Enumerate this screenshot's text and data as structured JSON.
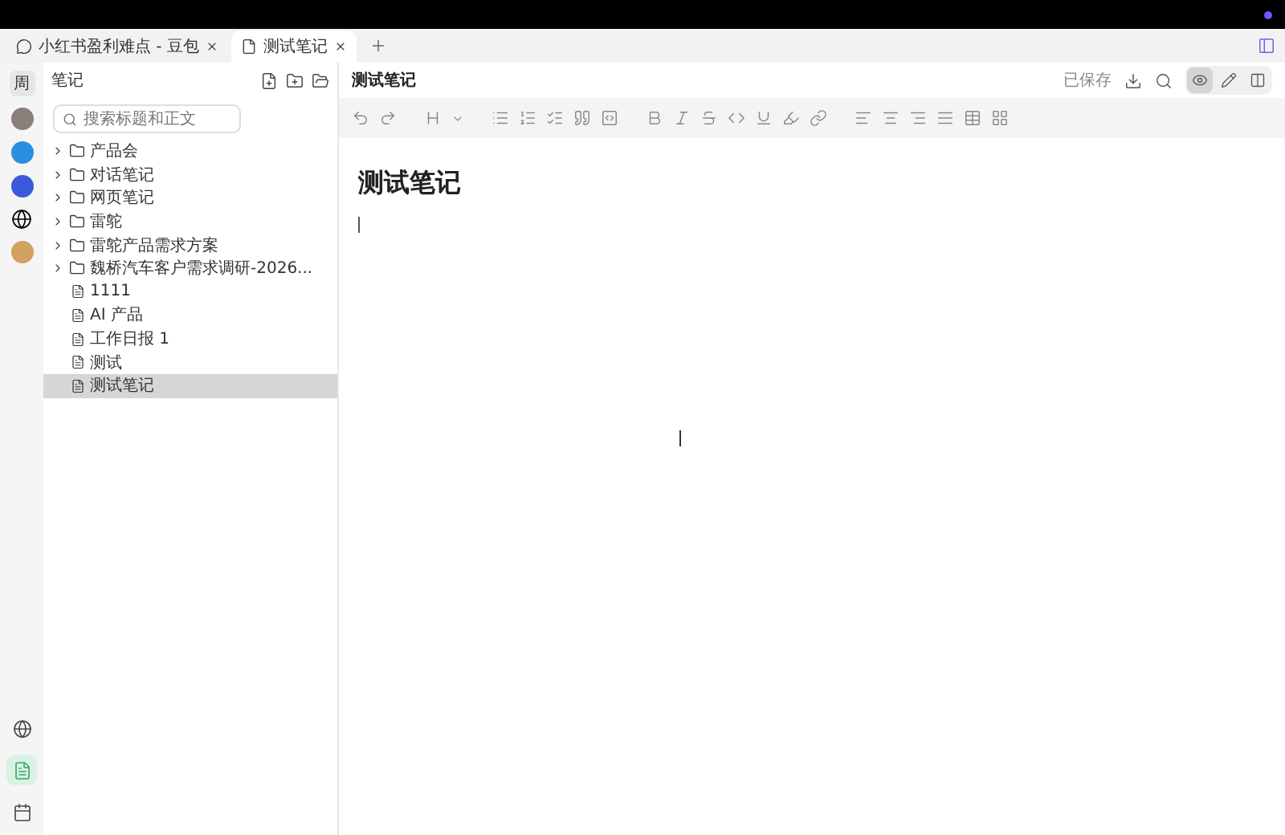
{
  "tabs": [
    {
      "title": "小红书盈利难点 - 豆包",
      "kind": "chat",
      "selected": false
    },
    {
      "title": "测试笔记",
      "kind": "doc",
      "selected": true
    }
  ],
  "rail": {
    "avatar": "周",
    "bottom": [
      {
        "kind": "globe",
        "selected": false
      },
      {
        "kind": "notes",
        "selected": true
      },
      {
        "kind": "calendar",
        "selected": false
      }
    ]
  },
  "sidebar": {
    "title": "笔记",
    "search": {
      "placeholder": "搜索标题和正文"
    },
    "items": [
      {
        "kind": "folder",
        "label": "产品会",
        "selected": false
      },
      {
        "kind": "folder",
        "label": "对话笔记",
        "selected": false
      },
      {
        "kind": "folder",
        "label": "网页笔记",
        "selected": false
      },
      {
        "kind": "folder",
        "label": "雷鸵",
        "selected": false
      },
      {
        "kind": "folder",
        "label": "雷鸵产品需求方案",
        "selected": false
      },
      {
        "kind": "folder",
        "label": "魏桥汽车客户需求调研-2026...",
        "selected": false
      },
      {
        "kind": "doc",
        "label": "1111",
        "selected": false
      },
      {
        "kind": "doc",
        "label": "AI 产品",
        "selected": false
      },
      {
        "kind": "doc",
        "label": "工作日报 1",
        "selected": false
      },
      {
        "kind": "doc",
        "label": "测试",
        "selected": false
      },
      {
        "kind": "doc",
        "label": "测试笔记",
        "selected": true
      }
    ]
  },
  "document": {
    "title": "测试笔记",
    "status": "已保存",
    "views": [
      {
        "kind": "read",
        "selected": true
      },
      {
        "kind": "edit",
        "selected": false
      },
      {
        "kind": "split",
        "selected": false
      }
    ],
    "heading": "测试笔记"
  }
}
